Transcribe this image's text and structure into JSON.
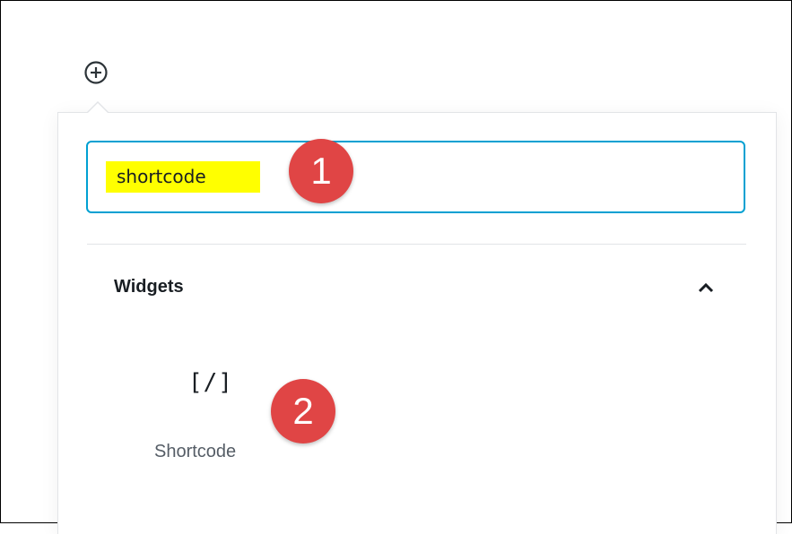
{
  "inserter": {
    "search": {
      "value": "shortcode",
      "highlight_color": "#ffff00",
      "focus_border_color": "#00a0d2"
    },
    "panel": {
      "title": "Widgets",
      "expanded": true,
      "blocks": [
        {
          "icon_text": "[/]",
          "label": "Shortcode"
        }
      ]
    }
  },
  "annotations": {
    "step_1": "1",
    "step_2": "2",
    "badge_color": "#e04545"
  },
  "icons": {
    "add_block": "plus-circle-icon",
    "collapse": "chevron-up-icon",
    "shortcode": "shortcode-icon"
  }
}
